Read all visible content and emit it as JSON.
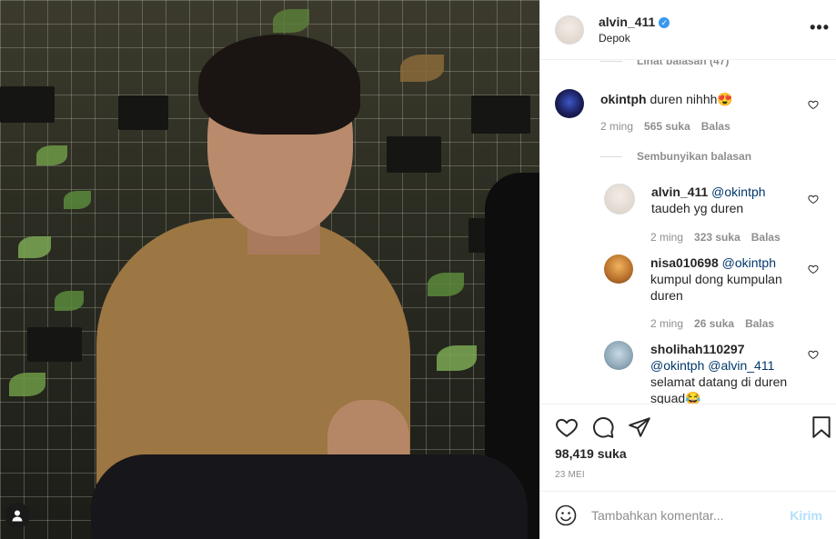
{
  "post": {
    "owner_username": "alvin_411",
    "location": "Depok",
    "likes": "98,419 suka",
    "date": "23 MEI"
  },
  "comments": {
    "view_replies_top": "Lihat balasan (47)",
    "hide_replies": "Sembunyikan balasan",
    "top_comment": {
      "username": "okintph",
      "text": "duren nihhh😍",
      "time": "2 ming",
      "likes": "565 suka",
      "reply": "Balas"
    },
    "replies": [
      {
        "username": "alvin_411",
        "mention": "@okintph",
        "text": "taudeh yg duren",
        "time": "2 ming",
        "likes": "323 suka",
        "reply": "Balas"
      },
      {
        "username": "nisa010698",
        "mention": "@okintph",
        "text": "kumpul dong kumpulan duren",
        "time": "2 ming",
        "likes": "26 suka",
        "reply": "Balas"
      },
      {
        "username": "sholihah110297",
        "mention": "@okintph @alvin_411",
        "text": "selamat datang di duren squad😂"
      }
    ]
  },
  "composer": {
    "placeholder": "Tambahkan komentar...",
    "post_label": "Kirim"
  },
  "icons": {
    "verified": "verified-badge-icon",
    "more": "more-options-icon",
    "like": "heart-icon",
    "comment": "comment-icon",
    "share": "share-icon",
    "save": "bookmark-icon",
    "emoji": "emoji-icon",
    "user_tag": "user-tag-icon"
  },
  "colors": {
    "link": "#00376b",
    "verified": "#3897f0",
    "post_button_disabled": "#b2dffc",
    "muted": "#8e8e8e"
  }
}
